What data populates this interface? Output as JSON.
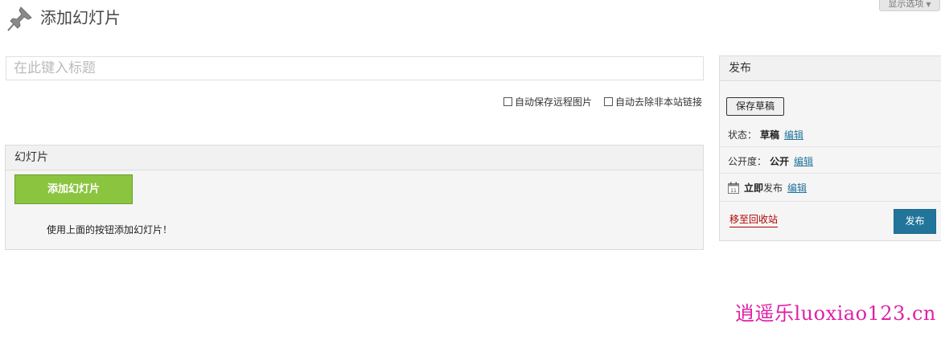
{
  "header": {
    "title": "添加幻灯片",
    "screen_options_label": "显示选项",
    "pin_icon": "pushpin-icon"
  },
  "title_input": {
    "placeholder": "在此键入标题",
    "value": ""
  },
  "options": {
    "auto_save_remote_images": {
      "label": "自动保存远程图片",
      "checked": false
    },
    "auto_remove_external_links": {
      "label": "自动去除非本站链接",
      "checked": false
    }
  },
  "slides_box": {
    "title": "幻灯片",
    "add_button_label": "添加幻灯片",
    "hint": "使用上面的按钮添加幻灯片！"
  },
  "publish_box": {
    "title": "发布",
    "save_draft_label": "保存草稿",
    "status_label": "状态：",
    "status_value": "草稿",
    "visibility_label": "公开度：",
    "visibility_value": "公开",
    "schedule_value": "立即",
    "schedule_suffix": "发布",
    "edit_label": "编辑",
    "calendar_icon": "calendar-icon",
    "trash_label": "移至回收站",
    "publish_label": "发布",
    "colors": {
      "publish_button": "#21759b",
      "link": "#21759b",
      "trash": "#b00000"
    }
  },
  "colors": {
    "add_button": "#8bc43f",
    "watermark": "#e020a8"
  },
  "watermark": "逍遥乐luoxiao123.cn"
}
